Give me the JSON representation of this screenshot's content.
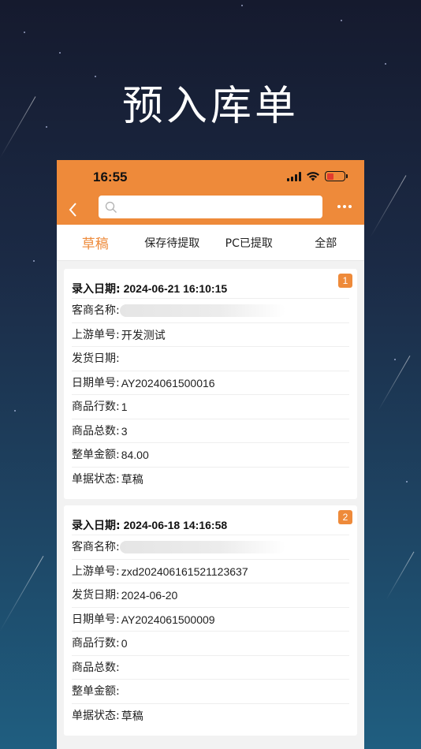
{
  "hero": {
    "title": "预入库单"
  },
  "status": {
    "time": "16:55"
  },
  "search": {
    "placeholder": ""
  },
  "tabs": [
    {
      "label": "草稿",
      "active": true
    },
    {
      "label": "保存待提取",
      "active": false
    },
    {
      "label": "PC已提取",
      "active": false
    },
    {
      "label": "全部",
      "active": false
    }
  ],
  "cards": [
    {
      "index": "1",
      "entry_label": "录入日期:",
      "entry_value": "2024-06-21 16:10:15",
      "rows": [
        {
          "label": "客商名称:",
          "value": "",
          "redacted": true
        },
        {
          "label": "上游单号:",
          "value": "开发测试"
        },
        {
          "label": "发货日期:",
          "value": ""
        },
        {
          "label": "日期单号:",
          "value": "AY2024061500016"
        },
        {
          "label": "商品行数:",
          "value": "1"
        },
        {
          "label": "商品总数:",
          "value": "3"
        },
        {
          "label": "整单金额:",
          "value": "84.00"
        },
        {
          "label": "单据状态:",
          "value": "草稿"
        }
      ]
    },
    {
      "index": "2",
      "entry_label": "录入日期:",
      "entry_value": "2024-06-18 14:16:58",
      "rows": [
        {
          "label": "客商名称:",
          "value": "",
          "redacted": true
        },
        {
          "label": "上游单号:",
          "value": "zxd202406161521123637"
        },
        {
          "label": "发货日期:",
          "value": "2024-06-20"
        },
        {
          "label": "日期单号:",
          "value": "AY2024061500009"
        },
        {
          "label": "商品行数:",
          "value": "0"
        },
        {
          "label": "商品总数:",
          "value": ""
        },
        {
          "label": "整单金额:",
          "value": ""
        },
        {
          "label": "单据状态:",
          "value": "草稿"
        }
      ]
    }
  ],
  "colors": {
    "accent": "#ee8a3a",
    "battery": "#e23b2e"
  },
  "icons": {
    "back": "chevron-left-icon",
    "search": "search-icon",
    "more": "more-dots-icon"
  }
}
